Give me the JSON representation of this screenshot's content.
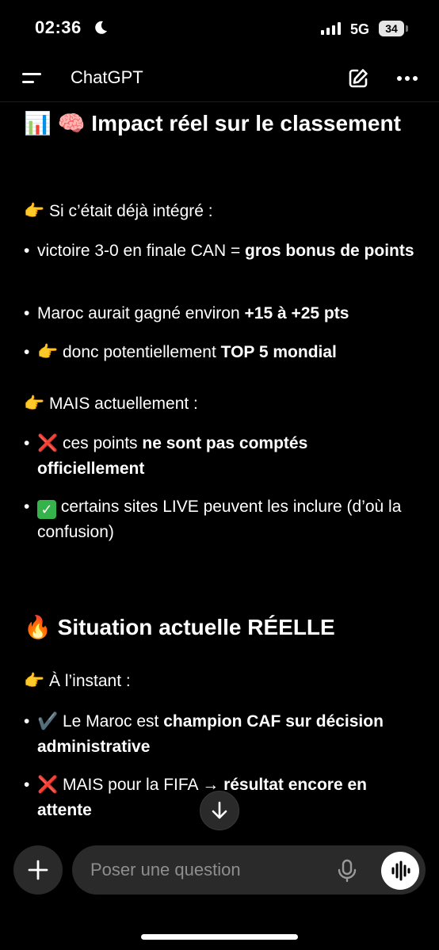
{
  "status_bar": {
    "time": "02:36",
    "network": "5G",
    "battery": "34"
  },
  "header": {
    "title": "ChatGPT"
  },
  "content": {
    "section1_title": "📊 🧠 Impact réel sur le classement",
    "intro1": "👉 Si c’était déjà intégré :",
    "list1": [
      {
        "pre": "victoire 3-0 en finale CAN = ",
        "bold": "gros bonus de points"
      },
      {
        "pre": "Maroc aurait gagné environ ",
        "bold": "+15 à +25 pts"
      },
      {
        "pre": "👉 donc potentiellement ",
        "bold": "TOP 5 mondial"
      }
    ],
    "intro2": "👉 MAIS actuellement :",
    "list2": [
      {
        "icon": "❌",
        "pre": " ces points ",
        "bold": "ne sont pas comptés officiellement"
      },
      {
        "icon": "✓",
        "pre": " certains sites LIVE peuvent les inclure (d’où la confusion)"
      }
    ],
    "section2_title": "🔥 Situation actuelle RÉELLE",
    "intro3": "👉 À l’instant :",
    "list3": [
      {
        "icon": "✔️",
        "pre": " Le Maroc est ",
        "bold": "champion CAF sur décision administrative"
      },
      {
        "icon": "❌",
        "pre": " MAIS pour la FIFA → ",
        "bold": "résultat encore en attente"
      }
    ]
  },
  "composer": {
    "placeholder": "Poser une question"
  }
}
